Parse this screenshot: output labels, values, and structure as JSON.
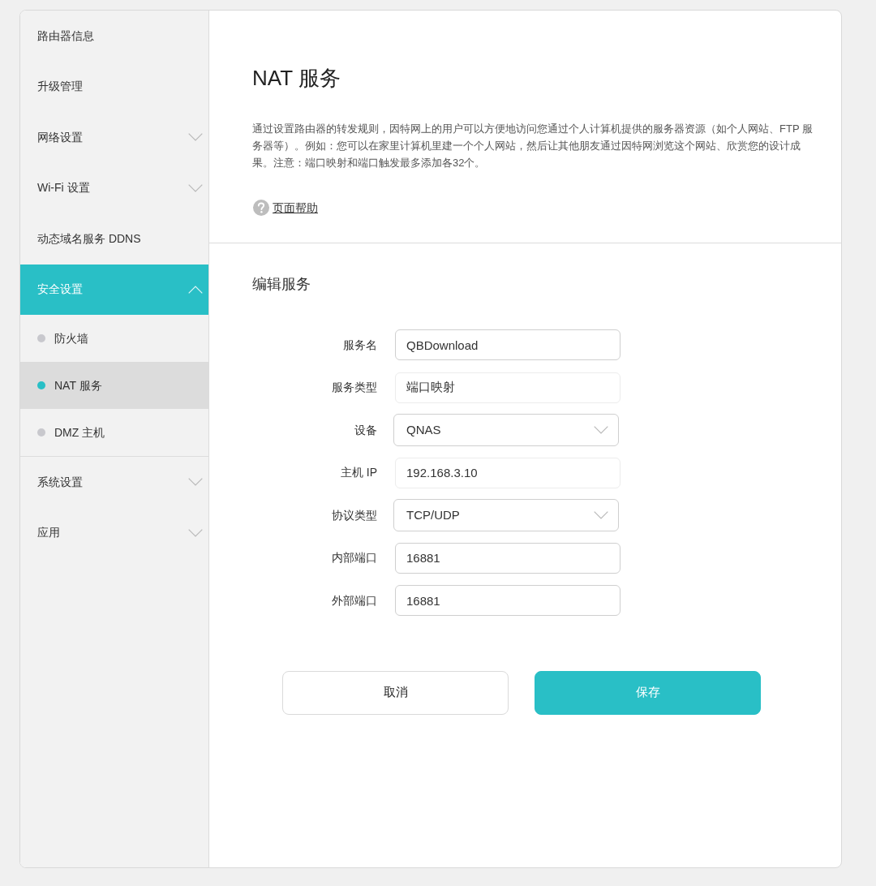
{
  "sidebar": {
    "items": [
      {
        "kind": "link",
        "label": "路由器信息",
        "selected": false
      },
      {
        "kind": "link",
        "label": "升级管理",
        "selected": false
      },
      {
        "kind": "group",
        "label": "网络设置",
        "selected": false,
        "expanded": false
      },
      {
        "kind": "group",
        "label": "Wi-Fi 设置",
        "selected": false,
        "expanded": false
      },
      {
        "kind": "link",
        "label": "动态域名服务 DDNS",
        "selected": false
      },
      {
        "kind": "group",
        "label": "安全设置",
        "selected": true,
        "expanded": true,
        "children": [
          {
            "label": "防火墙",
            "selected": false
          },
          {
            "label": "NAT 服务",
            "selected": true
          },
          {
            "label": "DMZ 主机",
            "selected": false
          }
        ]
      },
      {
        "kind": "group",
        "label": "系统设置",
        "selected": false,
        "expanded": false
      },
      {
        "kind": "group",
        "label": "应用",
        "selected": false,
        "expanded": false
      }
    ]
  },
  "page": {
    "title": "NAT 服务",
    "description": "通过设置路由器的转发规则，因特网上的用户可以方便地访问您通过个人计算机提供的服务器资源（如个人网站、FTP 服务器等）。例如：您可以在家里计算机里建一个个人网站，然后让其他朋友通过因特网浏览这个网站、欣赏您的设计成果。注意：端口映射和端口触发最多添加各32个。",
    "help_link": "页面帮助"
  },
  "form": {
    "title": "编辑服务",
    "fields": [
      {
        "kind": "text",
        "label": "服务名",
        "value": "QBDownload",
        "disabled": false
      },
      {
        "kind": "text",
        "label": "服务类型",
        "value": "端口映射",
        "disabled": true
      },
      {
        "kind": "select",
        "label": "设备",
        "value": "QNAS"
      },
      {
        "kind": "text",
        "label": "主机 IP",
        "value": "192.168.3.10",
        "disabled": true
      },
      {
        "kind": "select",
        "label": "协议类型",
        "value": "TCP/UDP"
      },
      {
        "kind": "text",
        "label": "内部端口",
        "value": "16881",
        "disabled": false
      },
      {
        "kind": "text",
        "label": "外部端口",
        "value": "16881",
        "disabled": false
      }
    ]
  },
  "buttons": [
    {
      "kind": "secondary",
      "label": "取消"
    },
    {
      "kind": "primary",
      "label": "保存"
    }
  ]
}
